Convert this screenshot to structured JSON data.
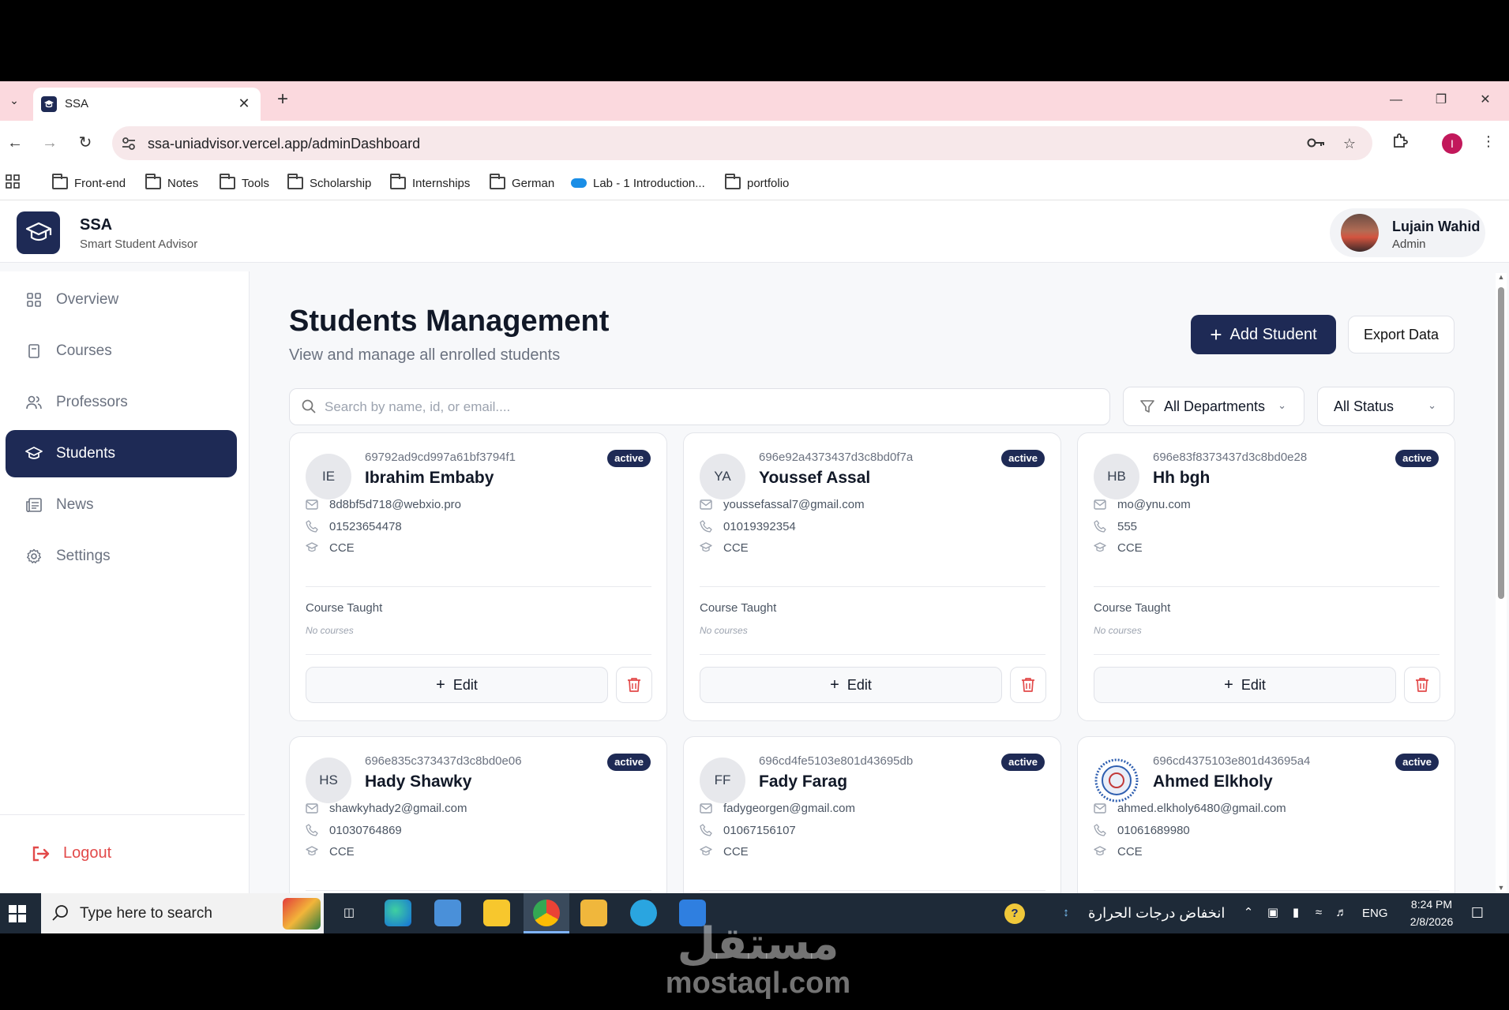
{
  "browser": {
    "tab_title": "SSA",
    "url": "ssa-uniadvisor.vercel.app/adminDashboard",
    "bookmarks": [
      "Front-end",
      "Notes",
      "Tools",
      "Scholarship",
      "Internships",
      "German",
      "Lab - 1 Introduction...",
      "portfolio"
    ],
    "profile_initial": "I"
  },
  "app": {
    "brand": "SSA",
    "brand_sub": "Smart Student Advisor",
    "user": {
      "name": "Lujain Wahid",
      "role": "Admin"
    }
  },
  "sidebar": {
    "items": [
      {
        "label": "Overview",
        "icon": "grid-icon"
      },
      {
        "label": "Courses",
        "icon": "book-icon"
      },
      {
        "label": "Professors",
        "icon": "users-icon"
      },
      {
        "label": "Students",
        "icon": "graduation-cap-icon",
        "active": true
      },
      {
        "label": "News",
        "icon": "newspaper-icon"
      },
      {
        "label": "Settings",
        "icon": "gear-icon"
      }
    ],
    "logout": "Logout"
  },
  "main": {
    "title": "Students Management",
    "subtitle": "View and manage all enrolled students",
    "add_label": "Add Student",
    "export_label": "Export Data",
    "search_placeholder": "Search by name, id, or email....",
    "dept_filter": "All Departments",
    "status_filter": "All Status"
  },
  "card_labels": {
    "course_taught": "Course Taught",
    "no_courses": "No courses",
    "edit": "Edit"
  },
  "students": [
    {
      "initials": "IE",
      "id": "69792ad9cd997a61bf3794f1",
      "name": "Ibrahim Embaby",
      "status": "active",
      "email": "8d8bf5d718@webxio.pro",
      "phone": "01523654478",
      "dept": "CCE"
    },
    {
      "initials": "YA",
      "id": "696e92a4373437d3c8bd0f7a",
      "name": "Youssef Assal",
      "status": "active",
      "email": "youssefassal7@gmail.com",
      "phone": "01019392354",
      "dept": "CCE"
    },
    {
      "initials": "HB",
      "id": "696e83f8373437d3c8bd0e28",
      "name": "Hh bgh",
      "status": "active",
      "email": "mo@ynu.com",
      "phone": "555",
      "dept": "CCE"
    },
    {
      "initials": "HS",
      "id": "696e835c373437d3c8bd0e06",
      "name": "Hady Shawky",
      "status": "active",
      "email": "shawkyhady2@gmail.com",
      "phone": "01030764869",
      "dept": "CCE"
    },
    {
      "initials": "FF",
      "id": "696cd4fe5103e801d43695db",
      "name": "Fady Farag",
      "status": "active",
      "email": "fadygeorgen@gmail.com",
      "phone": "01067156107",
      "dept": "CCE"
    },
    {
      "initials": "",
      "id": "696cd4375103e801d43695a4",
      "name": "Ahmed Elkholy",
      "status": "active",
      "email": "ahmed.elkholy6480@gmail.com",
      "phone": "01061689980",
      "dept": "CCE"
    }
  ],
  "taskbar": {
    "search_placeholder": "Type here to search",
    "weather": "انخفاض درجات الحرارة",
    "lang": "ENG",
    "time": "8:24 PM",
    "date": "2/8/2026"
  },
  "watermark": {
    "arabic": "مستقل",
    "latin": "mostaql.com"
  }
}
